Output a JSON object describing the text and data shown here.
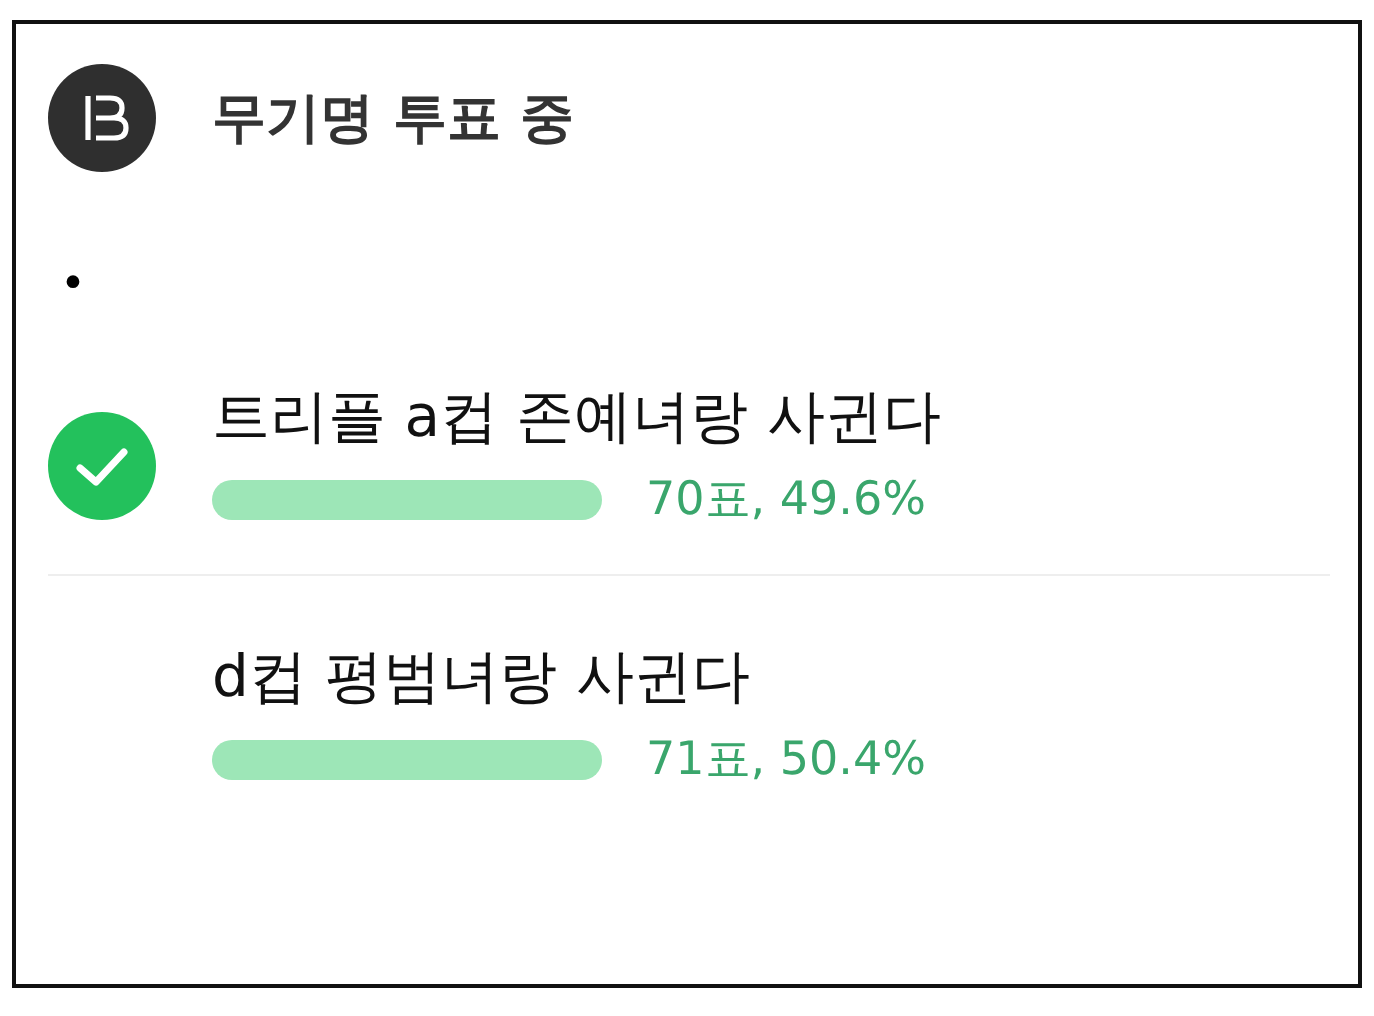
{
  "poll": {
    "title": "무기명 투표 중",
    "bullet": "•",
    "options": [
      {
        "label": "트리플 a컵 존예녀랑 사귄다",
        "selected": true,
        "result": "70표, 49.6%"
      },
      {
        "label": "d컵 평범녀랑 사귄다",
        "selected": false,
        "result": "71표, 50.4%"
      }
    ]
  }
}
